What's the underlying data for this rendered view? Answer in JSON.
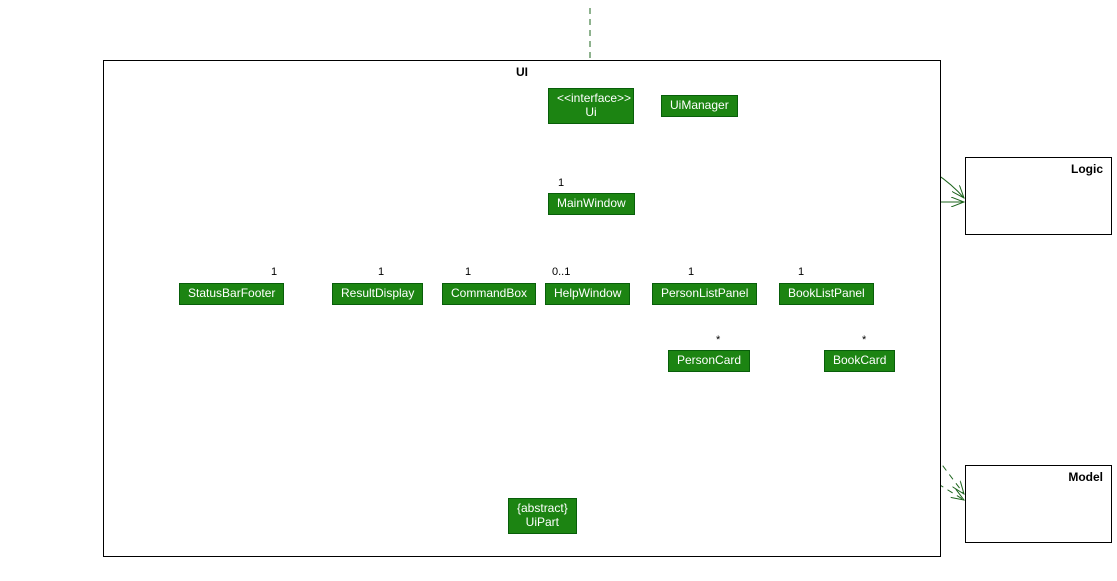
{
  "packages": {
    "ui": "UI",
    "logic": "Logic",
    "model": "Model"
  },
  "nodes": {
    "ui_iface": {
      "stereo": "<<interface>>",
      "name": "Ui"
    },
    "uimanager": "UiManager",
    "mainwindow": "MainWindow",
    "statusbar": "StatusBarFooter",
    "resultdisplay": "ResultDisplay",
    "commandbox": "CommandBox",
    "helpwindow": "HelpWindow",
    "personlist": "PersonListPanel",
    "booklist": "BookListPanel",
    "personcard": "PersonCard",
    "bookcard": "BookCard",
    "uipart": {
      "stereo": "{abstract}",
      "name": "UiPart"
    }
  },
  "multiplicities": {
    "mw1": "1",
    "sb1": "1",
    "rd1": "1",
    "cb1": "1",
    "hw01": "0..1",
    "plp1": "1",
    "blp1": "1",
    "pc_star": "*",
    "bc_star": "*"
  },
  "chart_data": {
    "type": "uml-class-diagram",
    "packages": [
      "UI",
      "Logic",
      "Model"
    ],
    "classes": [
      {
        "name": "Ui",
        "stereotype": "interface",
        "package": "UI"
      },
      {
        "name": "UiManager",
        "package": "UI"
      },
      {
        "name": "MainWindow",
        "package": "UI"
      },
      {
        "name": "StatusBarFooter",
        "package": "UI"
      },
      {
        "name": "ResultDisplay",
        "package": "UI"
      },
      {
        "name": "CommandBox",
        "package": "UI"
      },
      {
        "name": "HelpWindow",
        "package": "UI"
      },
      {
        "name": "PersonListPanel",
        "package": "UI"
      },
      {
        "name": "BookListPanel",
        "package": "UI"
      },
      {
        "name": "PersonCard",
        "package": "UI"
      },
      {
        "name": "BookCard",
        "package": "UI"
      },
      {
        "name": "UiPart",
        "stereotype": "abstract",
        "package": "UI"
      },
      {
        "name": "Logic",
        "package": "Logic"
      },
      {
        "name": "Model",
        "package": "Model"
      }
    ],
    "relationships": [
      {
        "from": "(external)",
        "to": "Ui",
        "type": "dependency"
      },
      {
        "from": "UiManager",
        "to": "Ui",
        "type": "realization"
      },
      {
        "from": "UiManager",
        "to": "Logic",
        "type": "association-arrow"
      },
      {
        "from": "UiManager",
        "to": "MainWindow",
        "type": "association-arrow",
        "multiplicity": "1"
      },
      {
        "from": "MainWindow",
        "to": "StatusBarFooter",
        "type": "composition",
        "multiplicity": "1"
      },
      {
        "from": "MainWindow",
        "to": "ResultDisplay",
        "type": "composition",
        "multiplicity": "1"
      },
      {
        "from": "MainWindow",
        "to": "CommandBox",
        "type": "composition",
        "multiplicity": "1"
      },
      {
        "from": "MainWindow",
        "to": "HelpWindow",
        "type": "composition",
        "multiplicity": "0..1"
      },
      {
        "from": "MainWindow",
        "to": "PersonListPanel",
        "type": "composition",
        "multiplicity": "1"
      },
      {
        "from": "MainWindow",
        "to": "BookListPanel",
        "type": "composition",
        "multiplicity": "1"
      },
      {
        "from": "MainWindow",
        "to": "Logic",
        "type": "association-arrow"
      },
      {
        "from": "PersonListPanel",
        "to": "PersonCard",
        "type": "association-arrow",
        "multiplicity": "*"
      },
      {
        "from": "BookListPanel",
        "to": "BookCard",
        "type": "association-arrow",
        "multiplicity": "*"
      },
      {
        "from": "MainWindow",
        "to": "UiPart",
        "type": "generalization"
      },
      {
        "from": "StatusBarFooter",
        "to": "UiPart",
        "type": "generalization"
      },
      {
        "from": "ResultDisplay",
        "to": "UiPart",
        "type": "generalization"
      },
      {
        "from": "CommandBox",
        "to": "UiPart",
        "type": "generalization"
      },
      {
        "from": "HelpWindow",
        "to": "UiPart",
        "type": "generalization"
      },
      {
        "from": "PersonListPanel",
        "to": "UiPart",
        "type": "generalization"
      },
      {
        "from": "BookListPanel",
        "to": "UiPart",
        "type": "generalization"
      },
      {
        "from": "PersonCard",
        "to": "UiPart",
        "type": "generalization"
      },
      {
        "from": "BookCard",
        "to": "UiPart",
        "type": "generalization"
      },
      {
        "from": "PersonCard",
        "to": "Model",
        "type": "dependency"
      },
      {
        "from": "BookCard",
        "to": "Model",
        "type": "dependency"
      }
    ]
  }
}
